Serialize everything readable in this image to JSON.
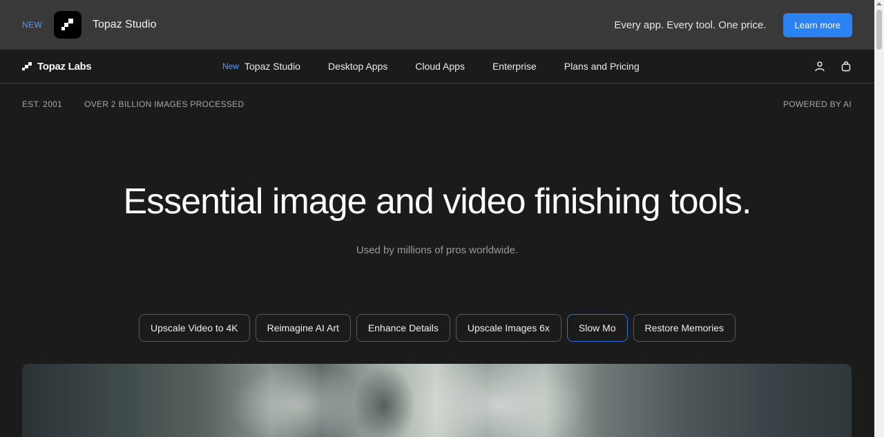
{
  "promo": {
    "badge": "NEW",
    "title": "Topaz Studio",
    "tagline": "Every app. Every tool. One price.",
    "cta_label": "Learn more"
  },
  "nav": {
    "brand": "Topaz Labs",
    "links": [
      {
        "badge": "New",
        "label": "Topaz Studio"
      },
      {
        "label": "Desktop Apps"
      },
      {
        "label": "Cloud Apps"
      },
      {
        "label": "Enterprise"
      },
      {
        "label": "Plans and Pricing"
      }
    ],
    "icons": [
      "account-icon",
      "cart-icon"
    ]
  },
  "info": {
    "established": "EST. 2001",
    "processed": "OVER 2 BILLION IMAGES PROCESSED",
    "powered": "POWERED BY AI"
  },
  "hero": {
    "title": "Essential image and video finishing tools.",
    "subtitle": "Used by millions of pros worldwide."
  },
  "pills": {
    "items": [
      {
        "label": "Upscale Video to 4K"
      },
      {
        "label": "Reimagine AI Art"
      },
      {
        "label": "Enhance Details"
      },
      {
        "label": "Upscale Images 6x"
      },
      {
        "label": "Slow Mo"
      },
      {
        "label": "Restore Memories"
      }
    ],
    "active": "Slow Mo"
  },
  "colors": {
    "accent": "#2b82f2",
    "new_badge": "#5a9bf5",
    "background": "#1c1b1c",
    "banner": "#3a393a"
  }
}
